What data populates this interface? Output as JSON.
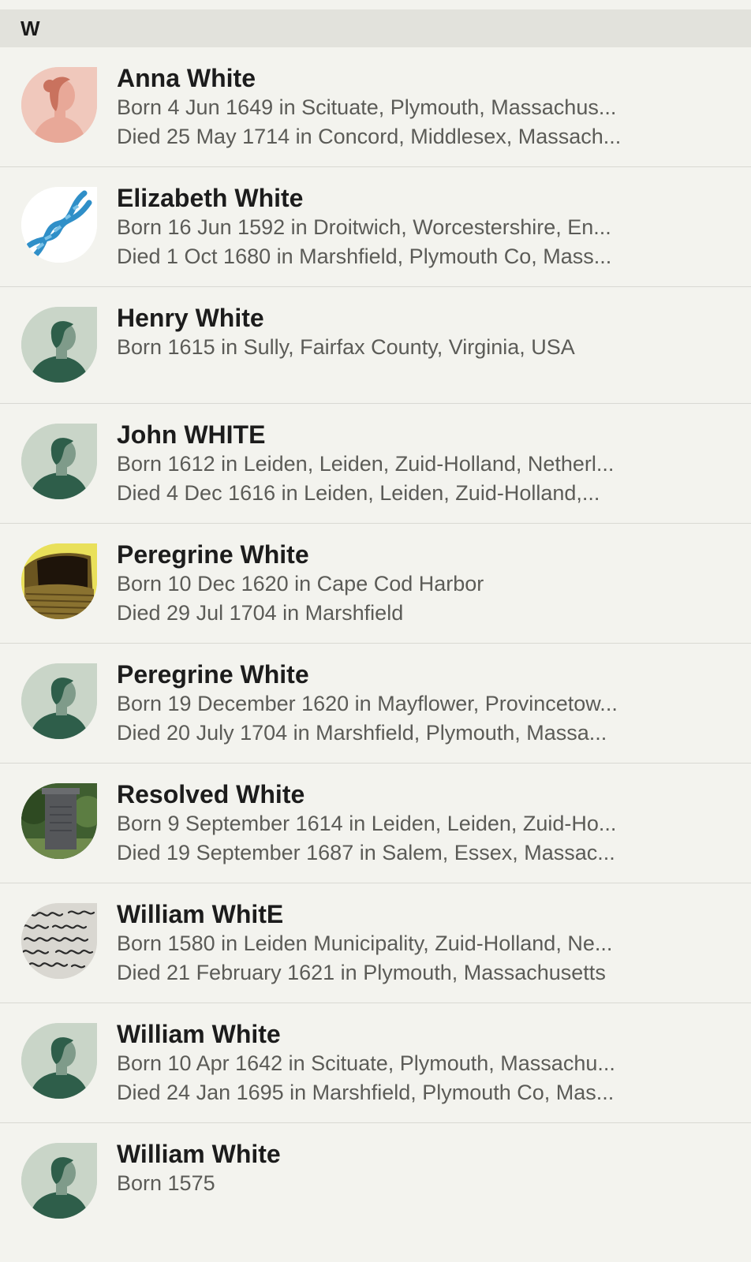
{
  "section": {
    "letter": "W"
  },
  "people": [
    {
      "name": "Anna White",
      "born": "Born 4 Jun 1649 in Scituate, Plymouth, Massachus...",
      "died": "Died 25 May 1714 in Concord, Middlesex, Massach...",
      "avatar": "female-silhouette-icon"
    },
    {
      "name": "Elizabeth White",
      "born": "Born 16 Jun 1592 in Droitwich, Worcestershire, En...",
      "died": "Died 1 Oct 1680 in Marshfield, Plymouth Co, Mass...",
      "avatar": "dna-icon"
    },
    {
      "name": "Henry White",
      "born": "Born 1615 in Sully, Fairfax County, Virginia, USA",
      "died": "",
      "avatar": "male-silhouette-icon"
    },
    {
      "name": "John WHITE",
      "born": "Born 1612 in Leiden, Leiden, Zuid-Holland, Netherl...",
      "died": "Died 4 Dec 1616 in Leiden, Leiden, Zuid-Holland,...",
      "avatar": "male-silhouette-icon"
    },
    {
      "name": "Peregrine White",
      "born": "Born 10 Dec 1620 in Cape Cod Harbor",
      "died": "Died 29 Jul 1704 in Marshfield",
      "avatar": "cradle-photo"
    },
    {
      "name": "Peregrine White",
      "born": "Born 19 December 1620 in Mayflower, Provincetow...",
      "died": "Died 20 July 1704 in Marshfield, Plymouth, Massa...",
      "avatar": "male-silhouette-icon"
    },
    {
      "name": "Resolved White",
      "born": "Born 9 September 1614 in Leiden, Leiden, Zuid-Ho...",
      "died": "Died 19 September 1687 in Salem, Essex, Massac...",
      "avatar": "gravestone-photo"
    },
    {
      "name": "William WhitE",
      "born": "Born 1580 in Leiden Municipality, Zuid-Holland, Ne...",
      "died": "Died 21 February 1621 in Plymouth, Massachusetts",
      "avatar": "handwritten-document-photo"
    },
    {
      "name": "William White",
      "born": "Born 10 Apr 1642 in Scituate, Plymouth, Massachu...",
      "died": "Died 24 Jan 1695 in Marshfield, Plymouth Co, Mas...",
      "avatar": "male-silhouette-icon"
    },
    {
      "name": "William White",
      "born": "Born 1575",
      "died": "",
      "avatar": "male-silhouette-icon"
    }
  ]
}
